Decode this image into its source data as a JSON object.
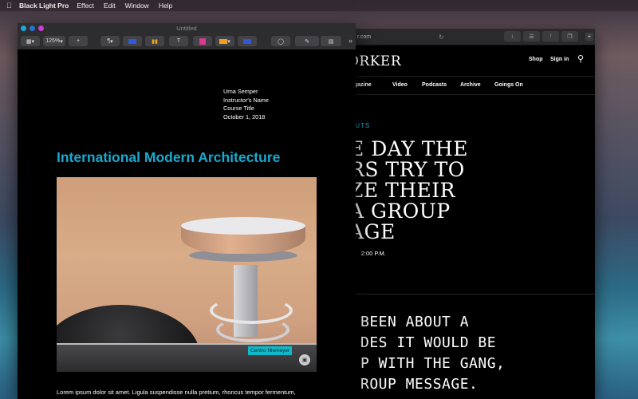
{
  "menubar": {
    "apple": "",
    "app_name": "Black Light Pro",
    "items": [
      "Effect",
      "Edit",
      "Window",
      "Help"
    ]
  },
  "browser": {
    "url": "r.com",
    "logo": "ORKER",
    "shop": "Shop",
    "signin": "Sign in",
    "nav": [
      "lagazine",
      "Video",
      "Podcasts",
      "Archive",
      "Goings On"
    ],
    "kicker": "OUTS",
    "headline": [
      "E DAY THE",
      "RS TRY TO",
      "ZE THEIR",
      "A GROUP",
      "AGE"
    ],
    "byline_time": "2:00 P.M.",
    "handwritten": [
      " BEEN ABOUT A",
      "DES IT WOULD BE",
      "P WITH THE GANG,",
      "ROUP MESSAGE."
    ]
  },
  "document": {
    "window_title": "Untitled",
    "toolbar": {
      "zoom": "125%",
      "paragraph": "¶",
      "text_tool": "T",
      "more": "»"
    },
    "address": {
      "name": "Urna Semper",
      "instructor": "Instructor's Name",
      "course": "Course Title",
      "date": "October 1, 2018"
    },
    "title": "International Modern Architecture",
    "photo_caption": "Centro Niemeyer",
    "body": "Lorem ipsum dolor sit amet. Ligula suspendisse nulla pretium, rhoncus tempor fermentum,"
  },
  "colors": {
    "accent_title": "#19a9cf",
    "caption_tag": "#11b9c8",
    "kicker": "#17b7c9",
    "light_red": "#ff5f57",
    "light_yellow": "#febc2e",
    "light_green": "#28c840"
  }
}
